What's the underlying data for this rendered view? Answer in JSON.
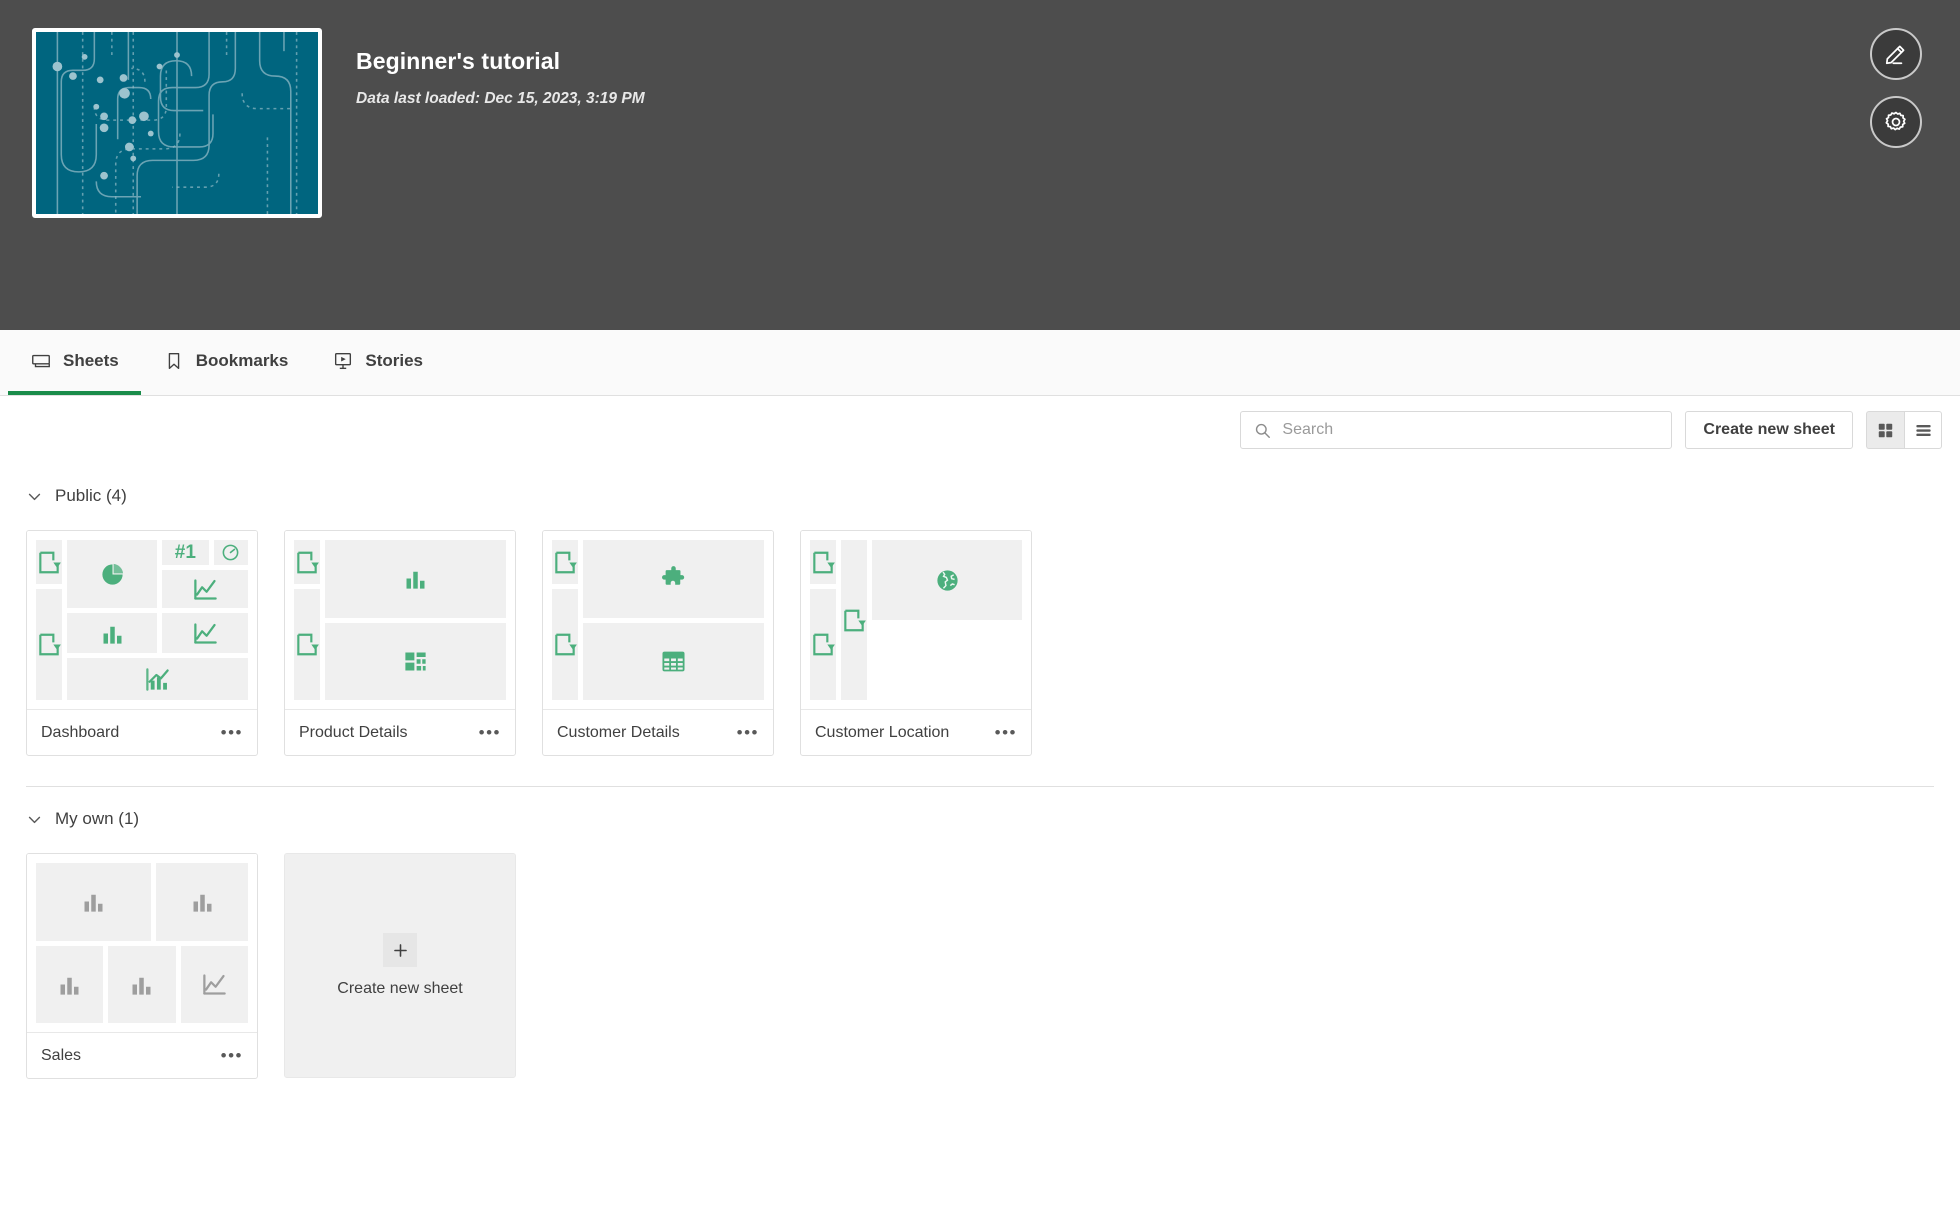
{
  "app": {
    "title": "Beginner's tutorial",
    "last_loaded": "Data last loaded: Dec 15, 2023, 3:19 PM",
    "thumbnail_color": "#00657f",
    "edit_button_label": "edit-sheet",
    "settings_button_label": "app-settings"
  },
  "tabs": [
    {
      "label": "Sheets",
      "icon": "sheet-icon",
      "active": true
    },
    {
      "label": "Bookmarks",
      "icon": "bookmark-icon",
      "active": false
    },
    {
      "label": "Stories",
      "icon": "story-icon",
      "active": false
    }
  ],
  "toolbar": {
    "search_placeholder": "Search",
    "search_value": "",
    "create_sheet_label": "Create new sheet",
    "grid_view_label": "grid-view",
    "list_view_label": "list-view",
    "active_view": "grid"
  },
  "sections": [
    {
      "title": "Public (4)",
      "expanded": true,
      "sheets": [
        {
          "name": "Dashboard",
          "published": true,
          "objects": [
            "filterpane",
            "filterpane",
            "pie-chart",
            "kpi",
            "gauge",
            "bar-chart",
            "line-chart",
            "combo-chart"
          ]
        },
        {
          "name": "Product Details",
          "published": true,
          "objects": [
            "filterpane",
            "filterpane",
            "bar-chart",
            "treemap"
          ]
        },
        {
          "name": "Customer Details",
          "published": true,
          "objects": [
            "filterpane",
            "filterpane",
            "extension",
            "table"
          ]
        },
        {
          "name": "Customer Location",
          "published": true,
          "objects": [
            "filterpane",
            "filterpane",
            "filterpane",
            "map"
          ]
        }
      ]
    },
    {
      "title": "My own (1)",
      "expanded": true,
      "sheets": [
        {
          "name": "Sales",
          "published": false,
          "objects": [
            "bar-chart",
            "bar-chart",
            "bar-chart",
            "bar-chart",
            "line-chart"
          ]
        }
      ],
      "create_card": {
        "label": "Create new sheet",
        "icon": "plus-icon"
      }
    }
  ],
  "colors": {
    "header_bg": "#4d4d4d",
    "accent_green": "#1a8c4a",
    "published_icon": "#4caf7d",
    "private_icon": "#9e9e9e",
    "tile_bg": "#f0f0f0"
  }
}
